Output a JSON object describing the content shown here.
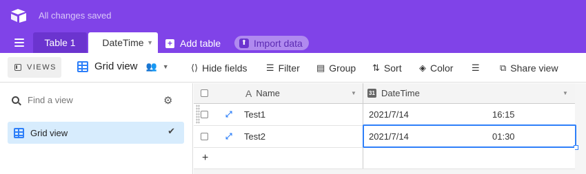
{
  "header": {
    "saved_status": "All changes saved",
    "tabs": [
      {
        "label": "Table 1"
      },
      {
        "label": "DateTime"
      }
    ],
    "add_table_label": "Add table",
    "import_label": "Import data",
    "accent_color": "#8043e8"
  },
  "toolbar": {
    "views_label": "VIEWS",
    "current_view": "Grid view",
    "hide_fields": "Hide fields",
    "filter": "Filter",
    "group": "Group",
    "sort": "Sort",
    "color": "Color",
    "share_view": "Share view"
  },
  "sidebar": {
    "find_placeholder": "Find a view",
    "views": [
      {
        "label": "Grid view",
        "selected": true
      }
    ]
  },
  "grid": {
    "columns": [
      {
        "label": "Name",
        "icon": "text-icon"
      },
      {
        "label": "DateTime",
        "icon": "calendar-icon"
      }
    ],
    "calendar_icon_text": "31",
    "rows": [
      {
        "name": "Test1",
        "date": "2021/7/14",
        "time": "16:15"
      },
      {
        "name": "Test2",
        "date": "2021/7/14",
        "time": "01:30"
      }
    ],
    "add_row_label": "+"
  }
}
